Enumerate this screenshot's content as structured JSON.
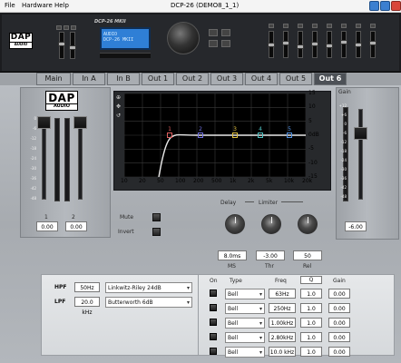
{
  "menu": {
    "file": "File",
    "hardware": "Hardware",
    "help": "Help"
  },
  "window": {
    "title": "DCP-26 (DEMO8_1_1)"
  },
  "hardware": {
    "logo_top": "DAP",
    "logo_bottom": "AUDIO",
    "model": "DCP-26 MKII",
    "lcd_line1": "AUDIO",
    "lcd_line2": "DCP-26 MKII"
  },
  "tabs": [
    "Main",
    "In A",
    "In B",
    "Out 1",
    "Out 2",
    "Out 3",
    "Out 4",
    "Out 5",
    "Out 6"
  ],
  "active_tab": "Out 6",
  "logo": {
    "top": "DAP",
    "bottom": "AUDIO"
  },
  "inputs": {
    "ch1_label": "1",
    "ch2_label": "2",
    "ch1_value": "0.00",
    "ch2_value": "0.00",
    "scale": [
      "0",
      "-6",
      "-12",
      "-18",
      "-24",
      "-30",
      "-36",
      "-42",
      "-48"
    ]
  },
  "graph": {
    "x_ticks": [
      "10",
      "20",
      "50",
      "100",
      "200",
      "500",
      "1k",
      "2k",
      "5k",
      "10k",
      "20k"
    ],
    "y_ticks": [
      "15",
      "10",
      "5",
      "0dB",
      "-5",
      "-10",
      "-15"
    ],
    "nodes": [
      "1",
      "2",
      "3",
      "4",
      "5"
    ],
    "node_colors": [
      "#e06060",
      "#7070e0",
      "#e0c040",
      "#50c0c0",
      "#5090e0"
    ],
    "curve_color": "#e8e8e8"
  },
  "gain": {
    "label": "Gain",
    "value": "-6.00",
    "scale": [
      "+12",
      "+6",
      "0",
      "-6",
      "-12",
      "-18",
      "-24",
      "-30",
      "-36",
      "-42",
      "-48"
    ]
  },
  "controls": {
    "mute": "Mute",
    "invert": "Invert",
    "delay": "Delay",
    "limiter": "Limiter",
    "delay_value": "8.0ms",
    "thr_value": "-3.00",
    "rel_value": "50",
    "ms": "MS",
    "thr": "Thr",
    "rel": "Rel"
  },
  "filters": {
    "hpf_label": "HPF",
    "hpf_freq": "50Hz",
    "hpf_type": "Linkwitz-Riley 24dB",
    "lpf_label": "LPF",
    "lpf_freq": "20.0 kHz",
    "lpf_type": "Butterworth 6dB"
  },
  "eq": {
    "headers": {
      "on": "On",
      "type": "Type",
      "freq": "Freq",
      "q": "Q",
      "gain": "Gain"
    },
    "rows": [
      {
        "type": "Bell",
        "freq": "63Hz",
        "q": "1.0",
        "gain": "0.00"
      },
      {
        "type": "Bell",
        "freq": "250Hz",
        "q": "1.0",
        "gain": "0.00"
      },
      {
        "type": "Bell",
        "freq": "1.00kHz",
        "q": "1.0",
        "gain": "0.00"
      },
      {
        "type": "Bell",
        "freq": "2.80kHz",
        "q": "1.0",
        "gain": "0.00"
      },
      {
        "type": "Bell",
        "freq": "10.0 kHz",
        "q": "1.0",
        "gain": "0.00"
      }
    ]
  }
}
